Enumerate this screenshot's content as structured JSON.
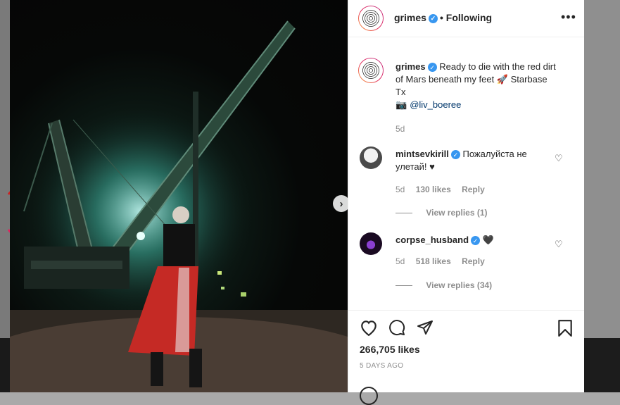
{
  "post": {
    "username": "grimes",
    "follow_status": "• Following",
    "caption": "Ready to die with the red dirt of Mars beneath my feet 🚀 Starbase Tx",
    "credit_handle": "@liv_boeree",
    "caption_time": "5d",
    "likes": "266,705 likes",
    "time_ago": "5 DAYS AGO"
  },
  "comments": [
    {
      "username": "mintsevkirill",
      "text": "Пожалуйста не улетай! ♥",
      "time": "5d",
      "likes": "130 likes",
      "reply_label": "Reply",
      "view_replies": "View replies (1)"
    },
    {
      "username": "corpse_husband",
      "text": "🖤",
      "time": "5d",
      "likes": "518 likes",
      "reply_label": "Reply",
      "view_replies": "View replies (34)"
    }
  ],
  "icons": {
    "verified": "verified-badge-icon",
    "more": "more-options-icon",
    "like": "heart-icon",
    "comment": "comment-icon",
    "share": "share-icon",
    "save": "bookmark-icon",
    "next": "chevron-right-icon"
  },
  "colors": {
    "verified": "#3897f0",
    "mention": "#00376b",
    "heart_red": "#c62828"
  }
}
